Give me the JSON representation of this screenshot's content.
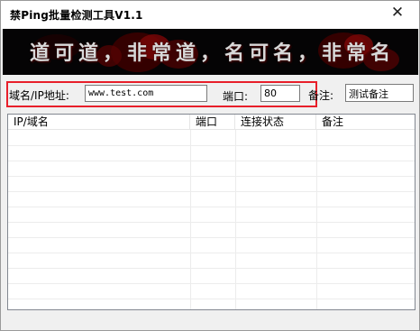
{
  "window": {
    "title": "禁Ping批量检测工具V1.1",
    "close_glyph": "✕"
  },
  "banner": {
    "text": "道可道，非常道，名可名，非常名"
  },
  "form": {
    "address_label": "域名/IP地址:",
    "address_value": "www.test.com",
    "port_label": "端口:",
    "port_value": "80",
    "note_label": "备注:",
    "note_value": "测试备注"
  },
  "table": {
    "columns": [
      "IP/域名",
      "端口",
      "连接状态",
      "备注"
    ],
    "rows": []
  },
  "colors": {
    "highlight": "#e81f2a",
    "banner_background": "#050405"
  }
}
